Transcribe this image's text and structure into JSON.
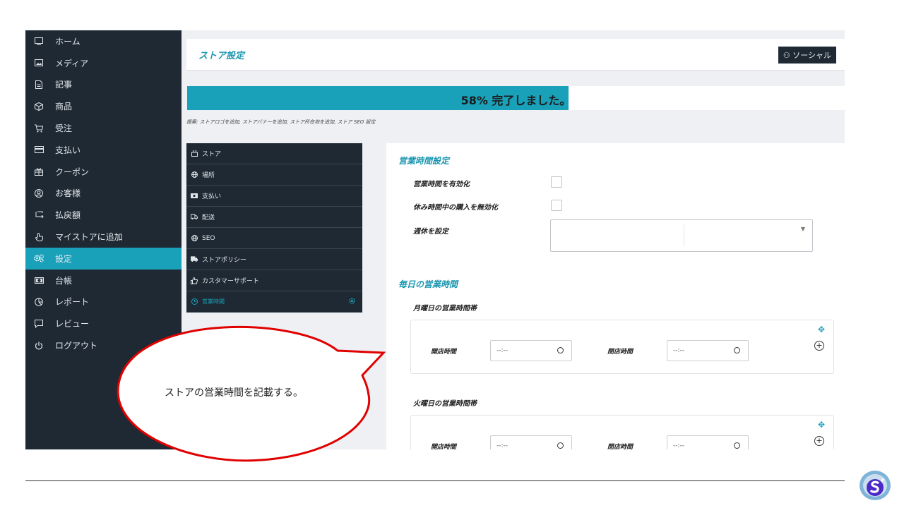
{
  "sidebar": {
    "items": [
      {
        "label": "ホーム",
        "icon": "monitor-icon"
      },
      {
        "label": "メディア",
        "icon": "image-icon"
      },
      {
        "label": "記事",
        "icon": "document-icon"
      },
      {
        "label": "商品",
        "icon": "box-icon"
      },
      {
        "label": "受注",
        "icon": "cart-icon"
      },
      {
        "label": "支払い",
        "icon": "credit-card-icon"
      },
      {
        "label": "クーポン",
        "icon": "gift-icon"
      },
      {
        "label": "お客様",
        "icon": "user-circle-icon"
      },
      {
        "label": "払戻額",
        "icon": "refund-icon"
      },
      {
        "label": "マイストアに追加",
        "icon": "hand-pointer-icon"
      },
      {
        "label": "設定",
        "icon": "gears-icon",
        "active": true
      },
      {
        "label": "台帳",
        "icon": "money-icon"
      },
      {
        "label": "レポート",
        "icon": "chart-icon"
      },
      {
        "label": "レビュー",
        "icon": "comment-icon"
      },
      {
        "label": "ログアウト",
        "icon": "power-icon"
      }
    ]
  },
  "header": {
    "title": "ストア設定",
    "social_label": "ソーシャル"
  },
  "progress": {
    "percent": 58,
    "text": "58% 完了しました。"
  },
  "hint": "提案: ストアロゴを追加, ストアバナーを追加, ストア所在地を追加, ストア SEO 設定",
  "tabs": [
    {
      "label": "ストア",
      "icon": "store-icon"
    },
    {
      "label": "場所",
      "icon": "globe-icon"
    },
    {
      "label": "支払い",
      "icon": "money-icon"
    },
    {
      "label": "配送",
      "icon": "truck-icon"
    },
    {
      "label": "SEO",
      "icon": "globe-icon"
    },
    {
      "label": "ストアポリシー",
      "icon": "truck-policy-icon"
    },
    {
      "label": "カスタマーサポート",
      "icon": "thumbs-up-icon"
    },
    {
      "label": "営業時間",
      "icon": "clock-icon",
      "active": true
    }
  ],
  "panel": {
    "section_business": "営業時間設定",
    "enable_label": "営業時間を有効化",
    "disable_purchase_label": "休み時間中の購入を無効化",
    "weekly_off_label": "週休を設定",
    "section_daily": "毎日の営業時間",
    "monday_label": "月曜日の営業時間帯",
    "tuesday_label": "火曜日の営業時間帯",
    "open_label": "開店時間",
    "close_label": "閉店時間",
    "time_placeholder": "--:--"
  },
  "callout": {
    "text": "ストアの営業時間を記載する。"
  },
  "colors": {
    "accent": "#1aa1ba",
    "sidebar": "#1e2934",
    "callout": "#e00000"
  }
}
